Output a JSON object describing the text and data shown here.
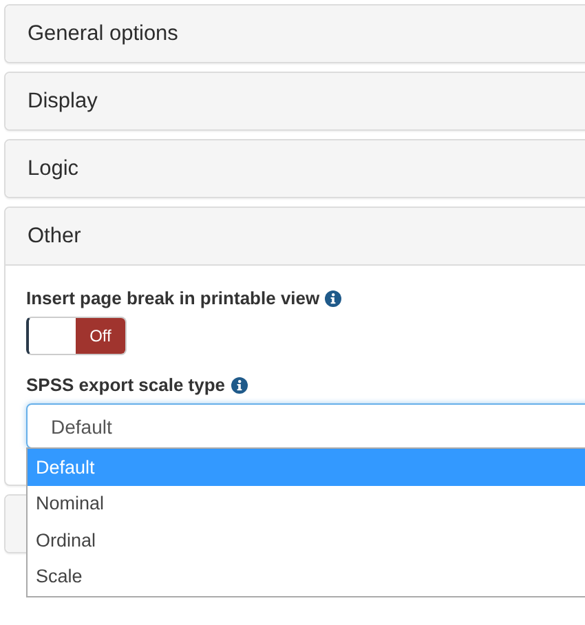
{
  "panels": [
    {
      "title": "General options",
      "expanded": false
    },
    {
      "title": "Display",
      "expanded": false
    },
    {
      "title": "Logic",
      "expanded": false
    },
    {
      "title": "Other",
      "expanded": true,
      "settings": [
        {
          "kind": "toggle",
          "label": "Insert page break in printable view",
          "on": false,
          "state_label": "Off"
        },
        {
          "kind": "select",
          "label": "SPSS export scale type",
          "value": "Default",
          "open": true,
          "options": [
            {
              "label": "Default",
              "selected": true
            },
            {
              "label": "Nominal",
              "selected": false
            },
            {
              "label": "Ordinal",
              "selected": false
            },
            {
              "label": "Scale",
              "selected": false
            }
          ]
        }
      ]
    },
    {
      "expanded": false
    }
  ]
}
